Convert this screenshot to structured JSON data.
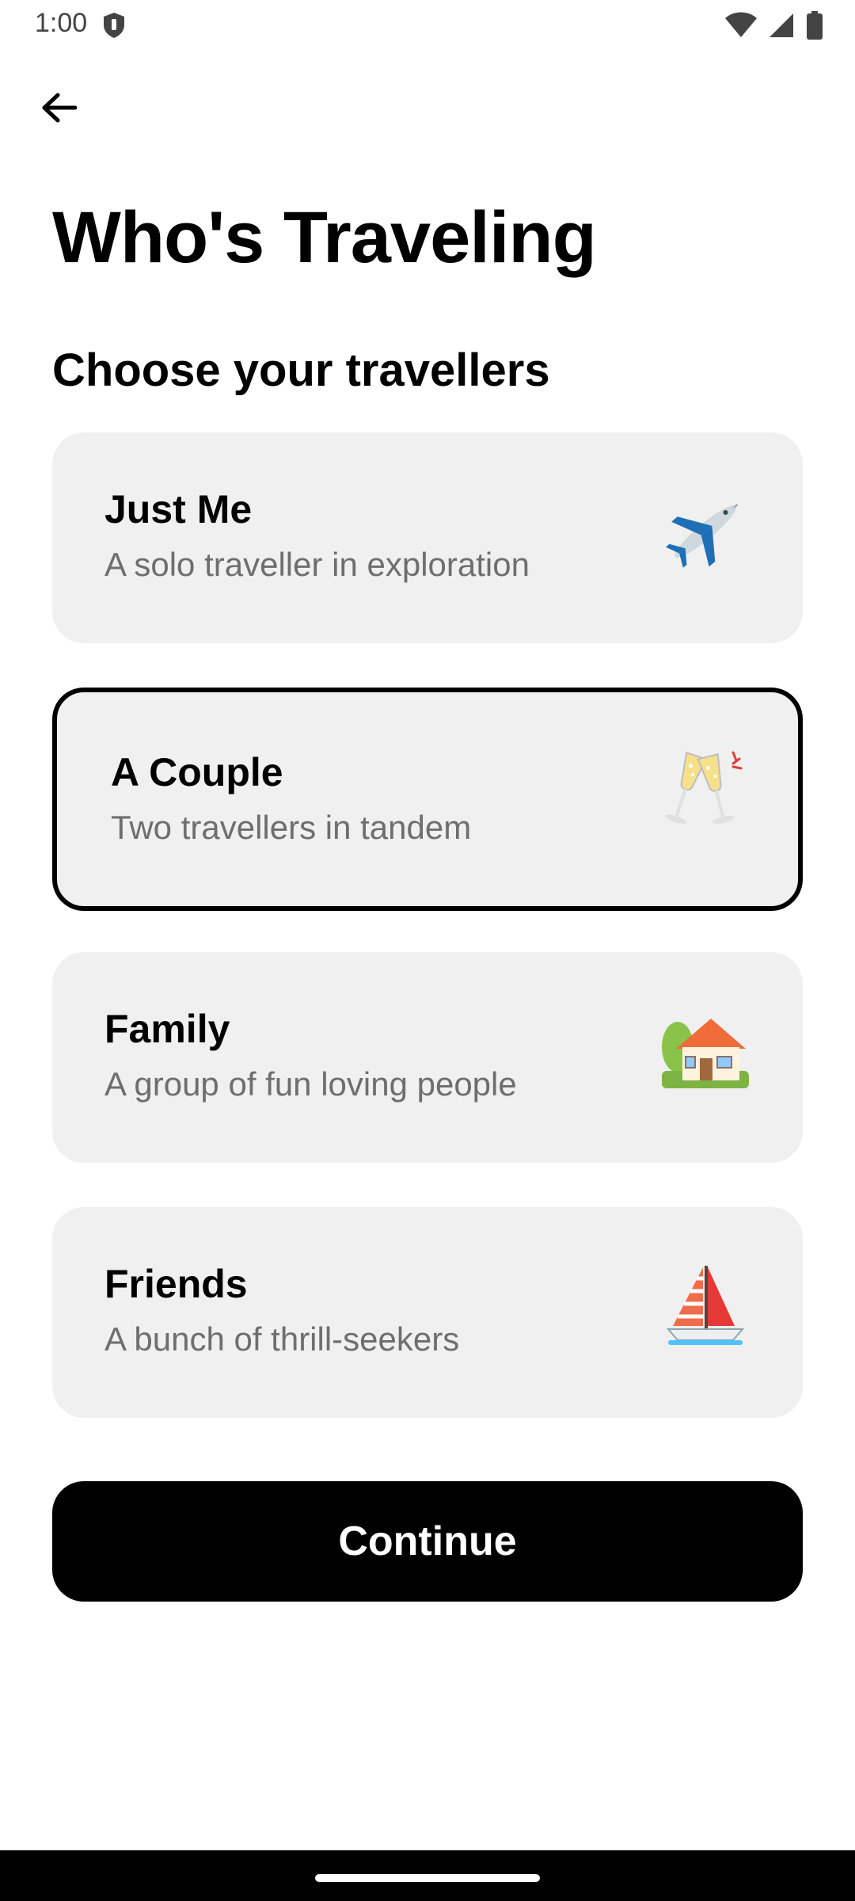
{
  "status_bar": {
    "time": "1:00",
    "icons": [
      "shield-icon",
      "wifi-icon",
      "cellular-icon",
      "battery-icon"
    ]
  },
  "header": {
    "back_icon": "arrow-left-icon",
    "title": "Who's Traveling",
    "subtitle": "Choose your travellers"
  },
  "options": [
    {
      "title": "Just Me",
      "description": "A solo traveller in exploration",
      "icon": "airplane-icon",
      "selected": false
    },
    {
      "title": "A Couple",
      "description": "Two travellers in tandem",
      "icon": "champagne-glasses-icon",
      "selected": true
    },
    {
      "title": "Family",
      "description": "A group of fun loving people",
      "icon": "house-icon",
      "selected": false
    },
    {
      "title": "Friends",
      "description": "A bunch of thrill-seekers",
      "icon": "sailboat-icon",
      "selected": false
    }
  ],
  "actions": {
    "continue_label": "Continue"
  },
  "colors": {
    "card_background": "#f0f0f0",
    "primary": "#000000",
    "secondary_text": "#6e6e6e"
  }
}
